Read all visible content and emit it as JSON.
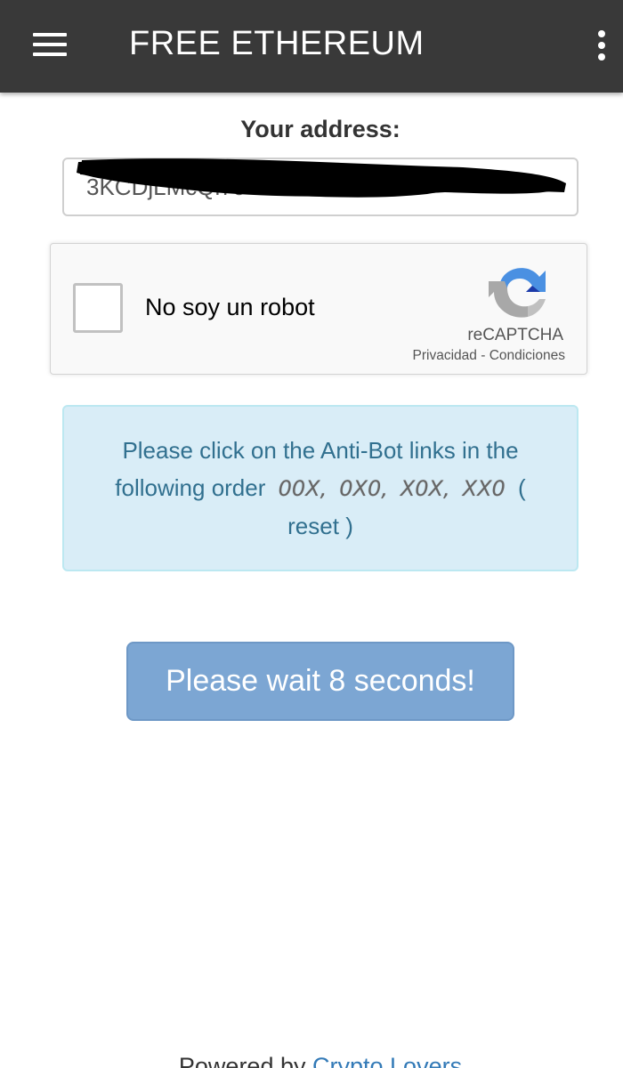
{
  "appbar": {
    "title": "FREE ETHEREUM",
    "menu_icon": "hamburger-menu-icon",
    "overflow_icon": "more-vert-icon",
    "background": "#393939"
  },
  "address": {
    "label": "Your address:",
    "value": "3KCDjLMcQi7c",
    "redacted": true
  },
  "recaptcha": {
    "checkbox_label": "No soy un robot",
    "brand": "reCAPTCHA",
    "privacy_link": "Privacidad",
    "separator": "-",
    "terms_link": "Condiciones",
    "logo_icon": "recaptcha-logo-icon"
  },
  "antibot": {
    "line1": "Please click on the Anti-Bot links in the",
    "line2": "following order",
    "links": [
      "00X,",
      "0X0,",
      "X0X,",
      "XX0"
    ],
    "open_paren": "(",
    "reset_label": "reset",
    "close_paren": ")",
    "background": "#d9edf7",
    "text_color": "#31708f"
  },
  "wait_button": {
    "label": "Please wait 8 seconds!",
    "background": "#7ca6d3"
  },
  "footer": {
    "prefix": "Powered by",
    "link_label": "Crypto Lovers",
    "link_color": "#337ab7"
  }
}
